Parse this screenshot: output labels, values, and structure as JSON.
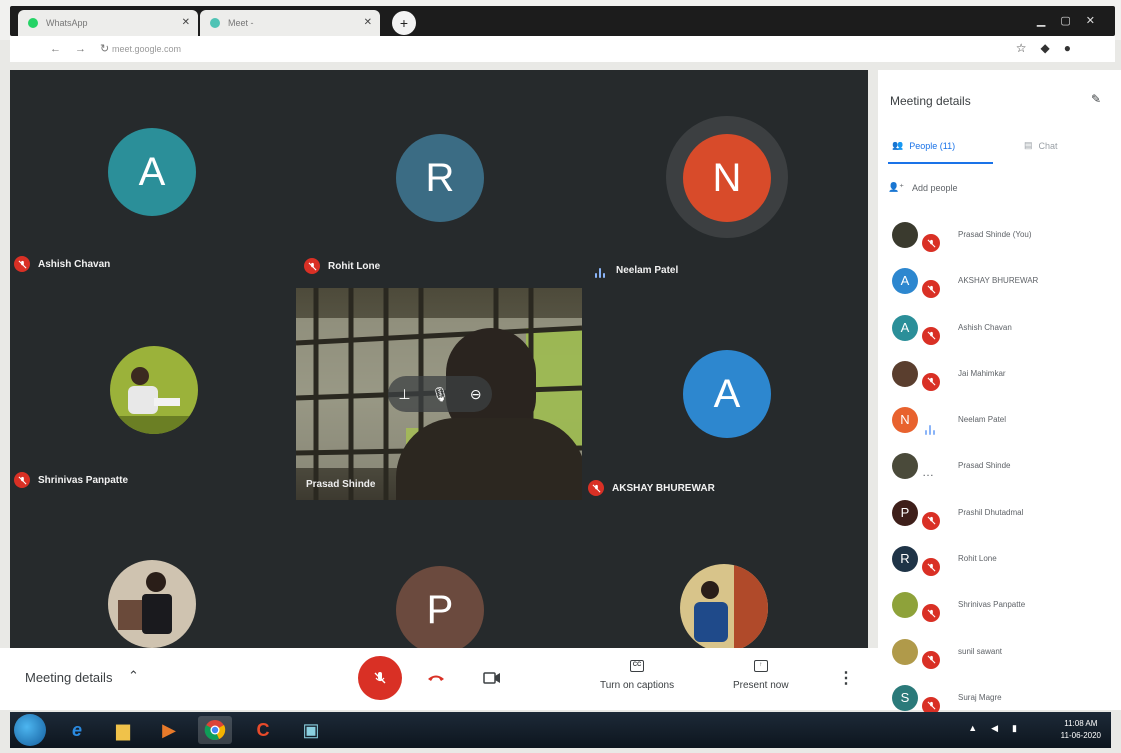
{
  "browser": {
    "tabs": [
      {
        "title": "WhatsApp",
        "fav_color": "#25d366"
      },
      {
        "title": "Meet -",
        "fav_color": "#4fc3b5"
      }
    ],
    "newtab_icon": "plus-icon",
    "url": "meet.google.com"
  },
  "grid": {
    "tiles": [
      {
        "kind": "avatar",
        "letter": "A",
        "color": "#2b8f99",
        "name": "Ashish Chavan",
        "status": "muted"
      },
      {
        "kind": "avatar",
        "letter": "R",
        "color": "#3b6c84",
        "name": "Rohit Lone",
        "status": "muted"
      },
      {
        "kind": "avatar",
        "letter": "N",
        "color": "#d84b2a",
        "name": "Neelam Patel",
        "status": "speaking"
      },
      {
        "kind": "photo",
        "name": "Shrinivas Panpatte",
        "status": "muted",
        "photo_color": "#9bb23a"
      },
      {
        "kind": "avatar",
        "letter": "A",
        "color": "#2d87cf",
        "name": "AKSHAY BHUREWAR",
        "status": "muted"
      },
      {
        "kind": "photo",
        "name": "",
        "status": "none",
        "photo_color": "#cfc3b0"
      },
      {
        "kind": "avatar",
        "letter": "P",
        "color": "#6b4a3e",
        "name": "",
        "status": "none"
      },
      {
        "kind": "photo",
        "name": "",
        "status": "none",
        "photo_color": "#d8c48a"
      }
    ],
    "self": {
      "name": "Prasad Shinde"
    }
  },
  "controls": {
    "meeting_details": "Meeting details",
    "captions": "Turn on captions",
    "captions_glyph": "CC",
    "present": "Present now"
  },
  "panel": {
    "title": "Meeting details",
    "people_tab": "People (11)",
    "chat_tab": "Chat",
    "add_people": "Add people",
    "people": [
      {
        "name": "Prasad Shinde (You)",
        "letter": "",
        "color": "#3a3a2e",
        "status": "muted"
      },
      {
        "name": "AKSHAY BHUREWAR",
        "letter": "A",
        "color": "#2d87cf",
        "status": "muted"
      },
      {
        "name": "Ashish Chavan",
        "letter": "A",
        "color": "#2b8f99",
        "status": "muted"
      },
      {
        "name": "Jai Mahimkar",
        "letter": "",
        "color": "#5a3e2e",
        "status": "muted"
      },
      {
        "name": "Neelam Patel",
        "letter": "N",
        "color": "#e8622e",
        "status": "speaking"
      },
      {
        "name": "Prasad Shinde",
        "letter": "",
        "color": "#4a4a3a",
        "status": "more"
      },
      {
        "name": "Prashil Dhutadmal",
        "letter": "P",
        "color": "#3e1f1a",
        "status": "muted"
      },
      {
        "name": "Rohit Lone",
        "letter": "R",
        "color": "#1f3447",
        "status": "muted"
      },
      {
        "name": "Shrinivas Panpatte",
        "letter": "",
        "color": "#8ea23a",
        "status": "muted"
      },
      {
        "name": "sunil sawant",
        "letter": "",
        "color": "#b09a4a",
        "status": "muted"
      },
      {
        "name": "Suraj Magre",
        "letter": "S",
        "color": "#2b7a7a",
        "status": "muted"
      }
    ]
  },
  "taskbar": {
    "time": "11:08 AM",
    "date": "11-06-2020"
  }
}
